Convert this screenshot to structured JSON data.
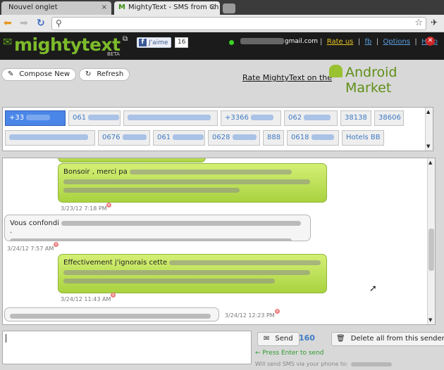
{
  "browser": {
    "tabs": [
      {
        "title": "Nouvel onglet"
      },
      {
        "title": "MightyText - SMS from Ch"
      }
    ],
    "tab_logo": "M",
    "close_glyph": "×"
  },
  "header": {
    "logo_text": "mightytext",
    "beta_label": "BETA",
    "fb_like_label": "J'aime",
    "fb_like_count": "16",
    "email_suffix": "gmail.com",
    "links": {
      "rate_us": "Rate us",
      "fb": "fb",
      "options": "Options",
      "help": "Help"
    },
    "separator": "|"
  },
  "toolbar": {
    "compose_label": "Compose New",
    "refresh_label": "Refresh",
    "rate_prefix": "Rate MightyText on the",
    "android_market": "Android Market"
  },
  "contacts": [
    {
      "label": "+33",
      "selected": true
    },
    {
      "label": "061"
    },
    {
      "label": ""
    },
    {
      "label": "+3366"
    },
    {
      "label": "062"
    },
    {
      "label": "38138"
    },
    {
      "label": "38606"
    },
    {
      "label": ""
    },
    {
      "label": "0676"
    },
    {
      "label": "061"
    },
    {
      "label": "0628"
    },
    {
      "label": "888"
    },
    {
      "label": "0618"
    },
    {
      "label": "Hotels BB"
    }
  ],
  "messages": [
    {
      "direction": "out",
      "text": "Bonsoir , merci pa",
      "timestamp": "3/23/12 7:18 PM"
    },
    {
      "direction": "in",
      "text": "Vous confondi",
      "trailing": ".",
      "timestamp": "3/24/12 7:57 AM"
    },
    {
      "direction": "out",
      "text": "Effectivement j'ignorais cette",
      "timestamp": "3/24/12 11:43 AM"
    },
    {
      "direction": "in",
      "text": "",
      "timestamp": "3/24/12 12:23 PM"
    }
  ],
  "composer": {
    "send_label": "Send",
    "char_count": "160",
    "delete_all_label": "Delete all from this sender",
    "press_enter_hint": "← Press Enter to send",
    "will_send_prefix": "Will send SMS via your phone to:"
  },
  "colors": {
    "accent_green": "#7dbb2b",
    "selected_chip": "#4a86e8",
    "outgoing_bubble": "#b9e05a",
    "rate_us": "#e6c31d",
    "online": "#3bd224"
  }
}
